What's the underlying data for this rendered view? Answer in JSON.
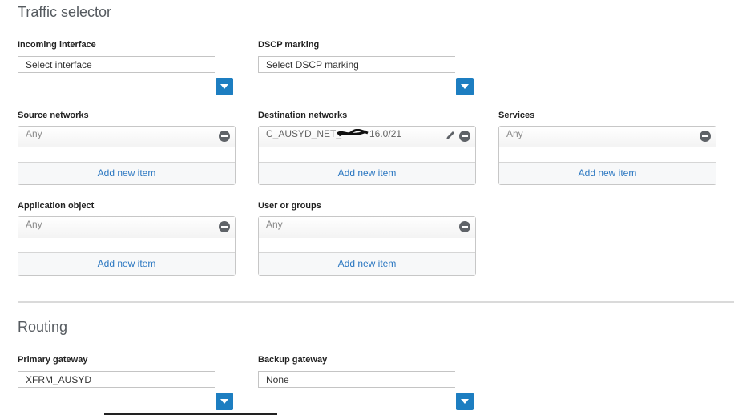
{
  "traffic_selector": {
    "title": "Traffic selector",
    "incoming_interface": {
      "label": "Incoming interface",
      "value": "Select interface"
    },
    "dscp_marking": {
      "label": "DSCP marking",
      "value": "Select DSCP marking"
    },
    "source_networks": {
      "label": "Source networks",
      "item": "Any",
      "add_label": "Add new item"
    },
    "destination_networks": {
      "label": "Destination networks",
      "item": "C_AUSYD_NET_10.••.16.0/21",
      "item_visible_prefix": "C_AUSYD_NET_",
      "item_visible_suffix": "16.0/21",
      "add_label": "Add new item"
    },
    "services": {
      "label": "Services",
      "item": "Any",
      "add_label": "Add new item"
    },
    "application_object": {
      "label": "Application object",
      "item": "Any",
      "add_label": "Add new item"
    },
    "user_or_groups": {
      "label": "User or groups",
      "item": "Any",
      "add_label": "Add new item"
    }
  },
  "routing": {
    "title": "Routing",
    "primary_gateway": {
      "label": "Primary gateway",
      "value": "XFRM_AUSYD"
    },
    "backup_gateway": {
      "label": "Backup gateway",
      "value": "None"
    }
  },
  "colors": {
    "accent": "#1d7ec1",
    "link": "#2b77c1",
    "label": "#222222",
    "heading": "#555a5f"
  },
  "icons": [
    "chevron-down-icon",
    "remove-icon",
    "edit-pencil-icon"
  ]
}
